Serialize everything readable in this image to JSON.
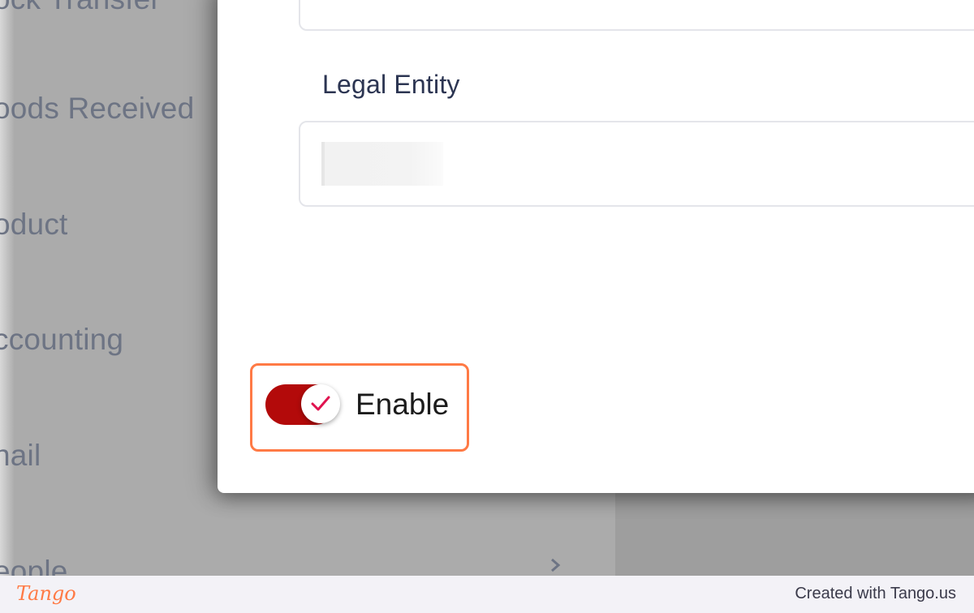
{
  "sidebar": {
    "items": [
      {
        "label": "ock Transfer"
      },
      {
        "label": "oods Received"
      },
      {
        "label": "oduct"
      },
      {
        "label": "ccounting"
      },
      {
        "label": "nail"
      },
      {
        "label": "eople"
      }
    ],
    "chevron_icon": "chevron-right-icon"
  },
  "dialog": {
    "legal_entity_label": "Legal Entity",
    "legal_entity_value": "",
    "enable_toggle": {
      "label": "Enable",
      "checked": true,
      "track_color": "#b30a0a",
      "check_color": "#e0134f"
    }
  },
  "highlight_color": "#ff7a45",
  "footer": {
    "logo": "Tango",
    "credit": "Created with Tango.us"
  }
}
